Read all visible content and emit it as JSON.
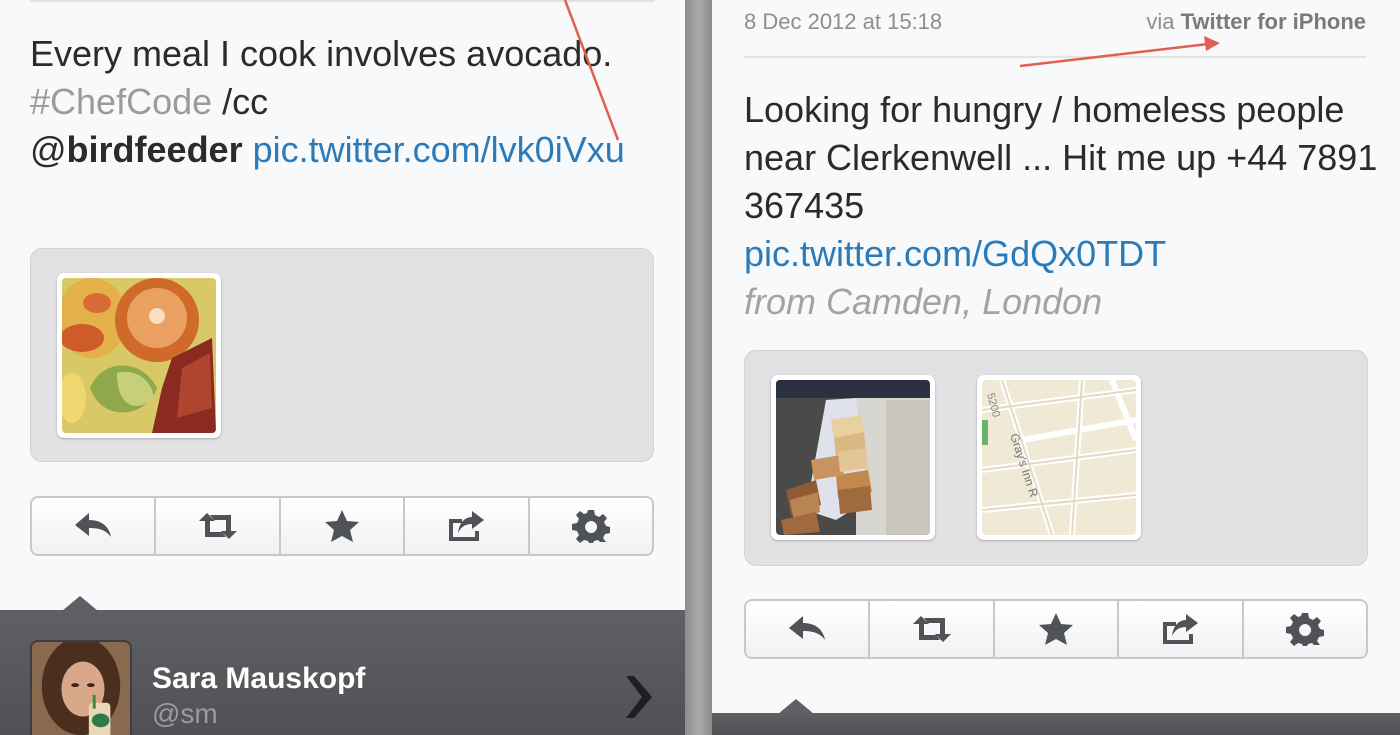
{
  "left_tweet": {
    "text_start": "Every meal I cook involves avocado.",
    "hashtag": "#ChefCode",
    "cc": "/cc",
    "mention_at": "@",
    "mention": "birdfeeder",
    "link": "pic.twitter.com/lvk0iVxu"
  },
  "right_tweet": {
    "date": "8 Dec 2012 at 15:18",
    "via_prefix": "via",
    "via_client": "Twitter for iPhone",
    "text": "Looking for hungry / homeless people near Clerkenwell ... Hit me up +44 7891 367435",
    "link": "pic.twitter.com/GdQx0TDT",
    "location": "from Camden, London",
    "map_label": "Gray's Inn R",
    "map_label_2": "5200"
  },
  "user": {
    "name": "Sara Mauskopf",
    "handle": "@sm"
  },
  "actions": [
    "reply-icon",
    "retweet-icon",
    "favorite-icon",
    "share-icon",
    "settings-icon"
  ],
  "colors": {
    "link": "#2b7bb9",
    "hashtag": "#9b9b9b",
    "annotation_arrow": "#e06050",
    "dark_bar": "#555659"
  }
}
